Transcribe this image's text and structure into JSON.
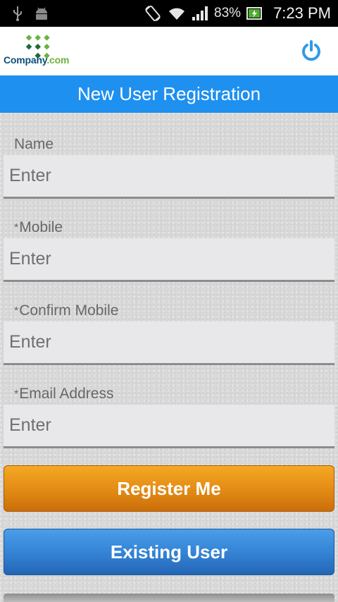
{
  "status_bar": {
    "battery_percent": "83%",
    "time": "7:23 PM",
    "icons": [
      "usb-icon",
      "android-icon",
      "rotate-icon",
      "wifi-icon",
      "signal-icon",
      "battery-charging-icon"
    ]
  },
  "header": {
    "logo_text_main": "Company",
    "logo_text_suffix": ".com",
    "power_icon": "power-icon"
  },
  "title": "New User Registration",
  "form": {
    "fields": [
      {
        "label": "Name",
        "required": false,
        "placeholder": "Enter",
        "value": ""
      },
      {
        "label": "Mobile",
        "required": true,
        "placeholder": "Enter",
        "value": ""
      },
      {
        "label": "Confirm Mobile",
        "required": true,
        "placeholder": "Enter",
        "value": ""
      },
      {
        "label": "Email Address",
        "required": true,
        "placeholder": "Enter",
        "value": ""
      }
    ],
    "required_marker": "*"
  },
  "buttons": {
    "register": "Register Me",
    "existing": "Existing User"
  },
  "colors": {
    "title_bar": "#1e90f0",
    "register_button": "#e58d16",
    "existing_button": "#3584d6",
    "power_icon": "#2d9be8",
    "logo_green": "#6cb33e",
    "logo_dark": "#0d4f7a"
  }
}
